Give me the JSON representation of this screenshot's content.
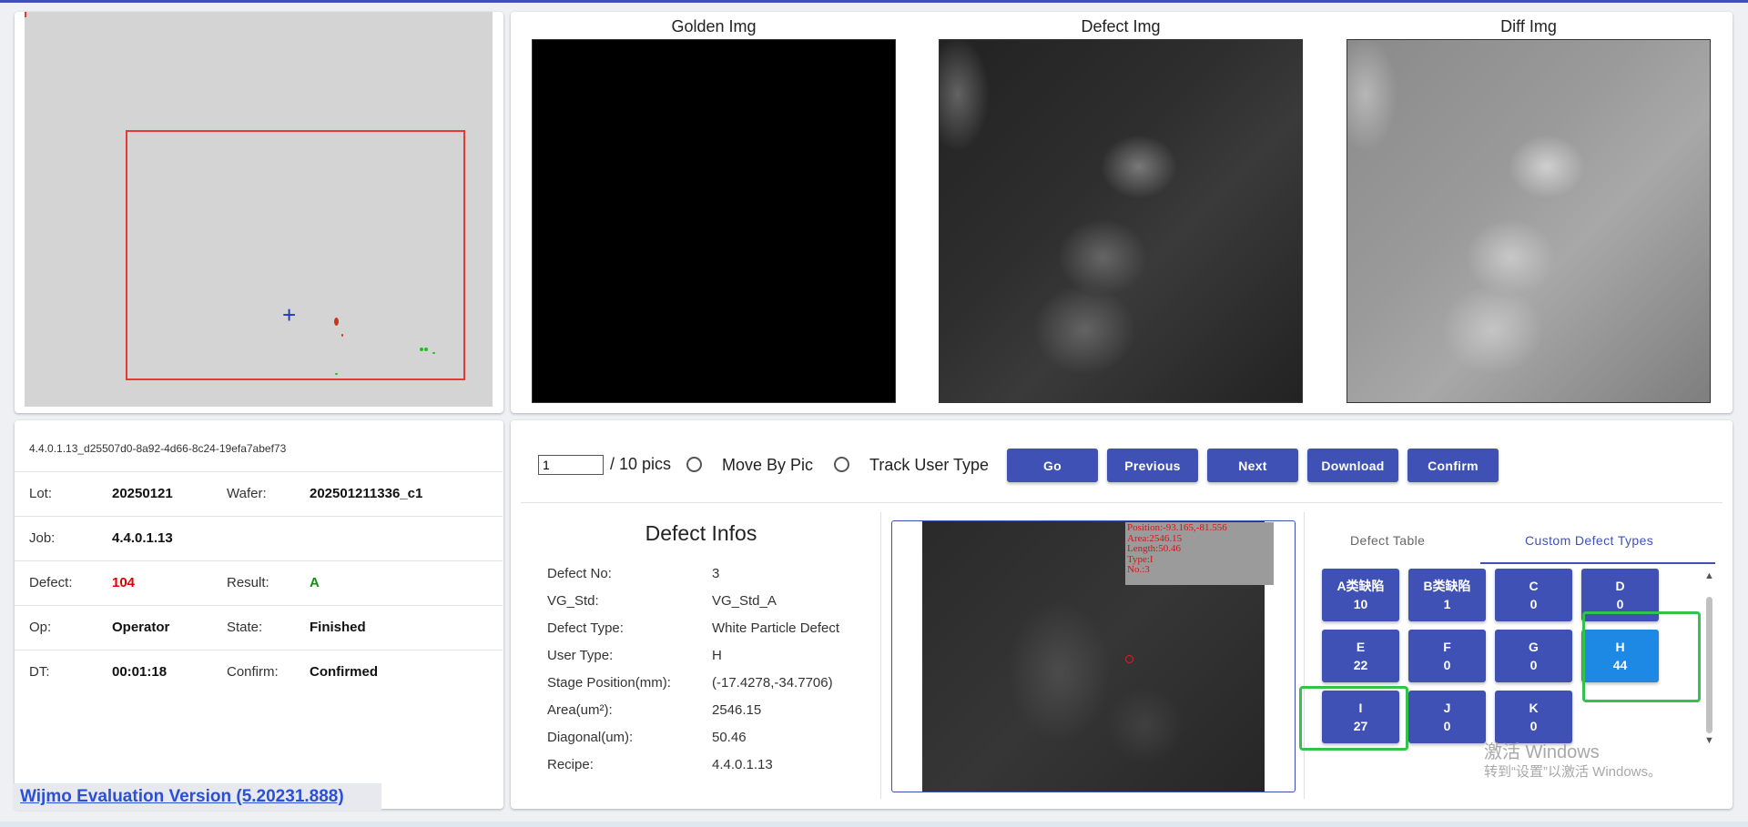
{
  "images": {
    "golden_title": "Golden Img",
    "defect_title": "Defect Img",
    "diff_title": "Diff Img"
  },
  "info": {
    "id": "4.4.0.1.13_d25507d0-8a92-4d66-8c24-19efa7abef73",
    "lot_label": "Lot:",
    "lot_value": "20250121",
    "wafer_label": "Wafer:",
    "wafer_value": "202501211336_c1",
    "job_label": "Job:",
    "job_value": "4.4.0.1.13",
    "defect_label": "Defect:",
    "defect_value": "104",
    "result_label": "Result:",
    "result_value": "A",
    "op_label": "Op:",
    "op_value": "Operator",
    "state_label": "State:",
    "state_value": "Finished",
    "dt_label": "DT:",
    "dt_value": "00:01:18",
    "confirm_label": "Confirm:",
    "confirm_value": "Confirmed"
  },
  "wijmo": "Wijmo Evaluation Version (5.20231.888)",
  "toolbar": {
    "pic_value": "1",
    "pic_total": "/ 10 pics",
    "move_by_pic": "Move By Pic",
    "track_user_type": "Track User Type",
    "go": "Go",
    "previous": "Previous",
    "next": "Next",
    "download": "Download",
    "confirm": "Confirm"
  },
  "defect_infos": {
    "title": "Defect Infos",
    "rows": [
      {
        "k": "Defect No:",
        "v": "3"
      },
      {
        "k": "VG_Std:",
        "v": "VG_Std_A"
      },
      {
        "k": "Defect Type:",
        "v": "White Particle Defect"
      },
      {
        "k": "User Type:",
        "v": "H"
      },
      {
        "k": "Stage Position(mm):",
        "v": "(-17.4278,-34.7706)"
      },
      {
        "k": "Area(um²):",
        "v": "2546.15"
      },
      {
        "k": "Diagonal(um):",
        "v": "50.46"
      },
      {
        "k": "Recipe:",
        "v": "4.4.0.1.13"
      }
    ]
  },
  "overlay": {
    "line1": "Position:-93.165,-81.556",
    "line2": "Area:2546.15",
    "line3": "Length:50.46",
    "line4": "Type:I",
    "line5": "No.:3"
  },
  "tabs": {
    "defect_table": "Defect Table",
    "custom_types": "Custom Defect Types"
  },
  "types": [
    {
      "name": "A类缺陷",
      "count": "10"
    },
    {
      "name": "B类缺陷",
      "count": "1"
    },
    {
      "name": "C",
      "count": "0"
    },
    {
      "name": "D",
      "count": "0"
    },
    {
      "name": "E",
      "count": "22"
    },
    {
      "name": "F",
      "count": "0"
    },
    {
      "name": "G",
      "count": "0"
    },
    {
      "name": "H",
      "count": "44"
    },
    {
      "name": "I",
      "count": "27"
    },
    {
      "name": "J",
      "count": "0"
    },
    {
      "name": "K",
      "count": "0"
    }
  ],
  "watermark": {
    "line1": "激活 Windows",
    "line2": "转到“设置”以激活 Windows。"
  },
  "colors": {
    "primary": "#3f51b5",
    "active_type": "#1e88e5",
    "highlight": "#35c24a",
    "defect_count": "#e00000",
    "result": "#1a8a1a"
  }
}
